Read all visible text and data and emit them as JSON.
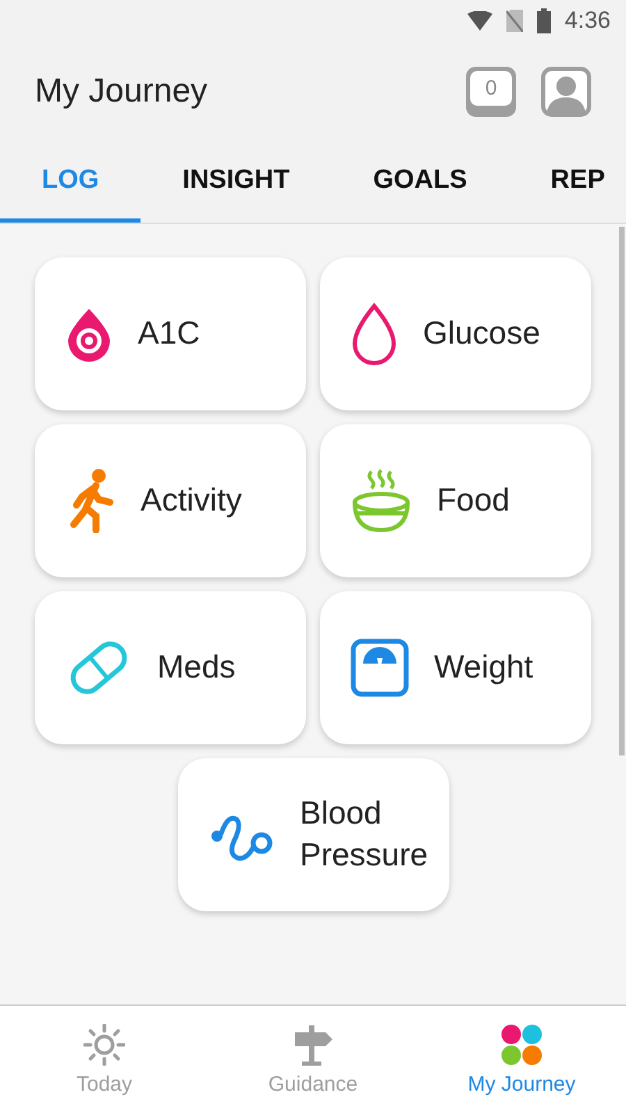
{
  "status_bar": {
    "time": "4:36"
  },
  "header": {
    "title": "My Journey",
    "notification_count": "0"
  },
  "tabs": [
    {
      "label": "LOG",
      "selected": true
    },
    {
      "label": "INSIGHT",
      "selected": false
    },
    {
      "label": "GOALS",
      "selected": false
    },
    {
      "label": "REP",
      "selected": false
    }
  ],
  "log_items": [
    {
      "label": "A1C",
      "kind": "a1c"
    },
    {
      "label": "Glucose",
      "kind": "glucose"
    },
    {
      "label": "Activity",
      "kind": "activity"
    },
    {
      "label": "Food",
      "kind": "food"
    },
    {
      "label": "Meds",
      "kind": "meds"
    },
    {
      "label": "Weight",
      "kind": "weight"
    },
    {
      "label": "Blood\nPressure",
      "kind": "blood-pressure"
    }
  ],
  "bottom_nav": [
    {
      "label": "Today",
      "kind": "today",
      "selected": false
    },
    {
      "label": "Guidance",
      "kind": "guidance",
      "selected": false
    },
    {
      "label": "My Journey",
      "kind": "journey",
      "selected": true
    }
  ]
}
